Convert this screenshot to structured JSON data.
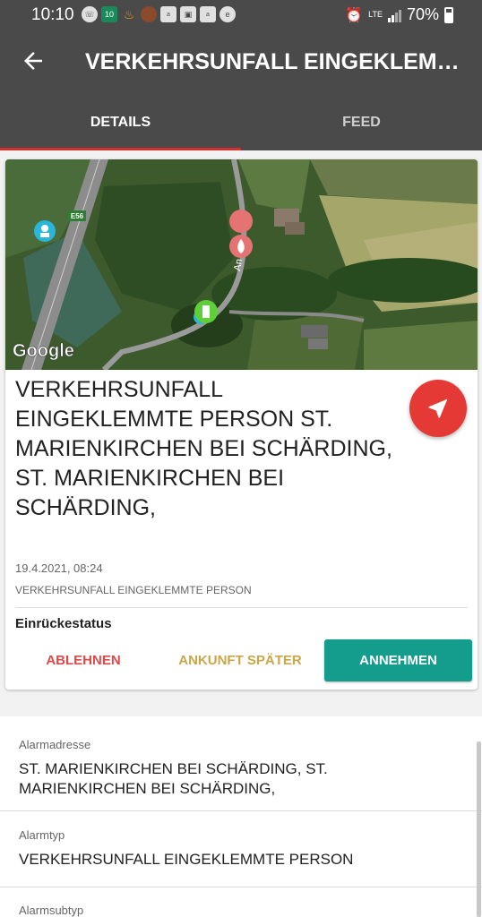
{
  "status_bar": {
    "time": "10:10",
    "network": "LTE",
    "battery": "70%",
    "notification_icons": [
      "whatsapp-icon",
      "calendar-icon",
      "flame-icon",
      "app-icon",
      "amazon-icon",
      "image-icon",
      "amazon-icon",
      "e-icon"
    ],
    "calendar_day": "10"
  },
  "app_bar": {
    "title": "VERKEHRSUNFALL EINGEKLEMMTE PERSON",
    "back_icon": "arrow-left-icon"
  },
  "tabs": [
    {
      "label": "DETAILS",
      "active": true
    },
    {
      "label": "FEED",
      "active": false
    }
  ],
  "map": {
    "road_label": "E56",
    "street_label": "An",
    "attribution": "Google",
    "markers": [
      "station-marker",
      "fire-marker",
      "vehicle-marker"
    ]
  },
  "card": {
    "title": "VERKEHRSUNFALL EINGEKLEMMTE PERSON ST. MARIENKIRCHEN BEI SCHÄRDING, ST. MARIENKIRCHEN BEI SCHÄRDING,",
    "date": "19.4.2021, 08:24",
    "subtitle": "VERKEHRSUNFALL EINGEKLEMMTE PERSON",
    "status_label": "Einrückestatus",
    "navigate_icon": "navigation-arrow-icon",
    "buttons": {
      "decline": "ABLEHNEN",
      "later": "ANKUNFT SPÄTER",
      "accept": "ANNEHMEN"
    }
  },
  "details": [
    {
      "label": "Alarmadresse",
      "value": "ST. MARIENKIRCHEN BEI SCHÄRDING, ST. MARIENKIRCHEN BEI SCHÄRDING,"
    },
    {
      "label": "Alarmtyp",
      "value": "VERKEHRSUNFALL EINGEKLEMMTE PERSON"
    },
    {
      "label": "Alarmsubtyp",
      "value": ""
    }
  ],
  "colors": {
    "toolbar": "#4a4a4a",
    "tab_indicator": "#d32f2f",
    "navigate": "#e53935",
    "decline": "#e04848",
    "later": "#c9a648",
    "accept": "#149c8c"
  }
}
